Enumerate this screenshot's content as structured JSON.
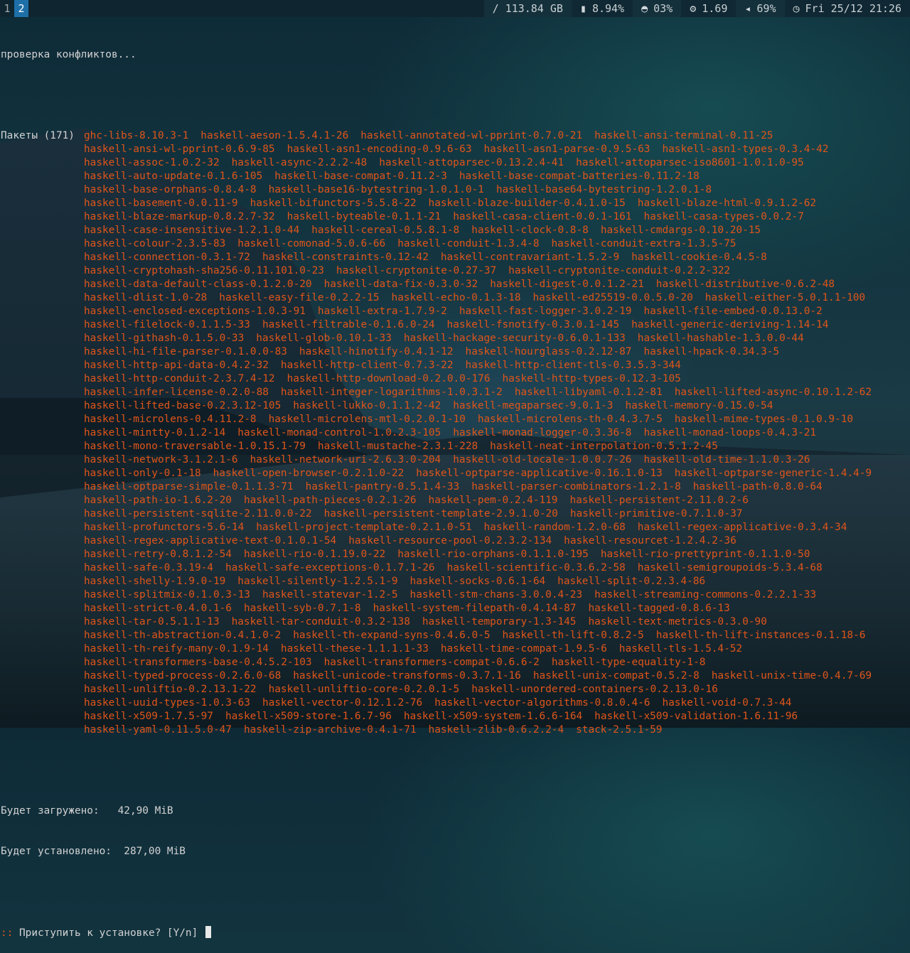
{
  "workspaces": [
    {
      "label": "1",
      "active": false
    },
    {
      "label": "2",
      "active": true
    }
  ],
  "status": {
    "disk": {
      "icon": "folder-slash-icon",
      "value": "/ 113.84 GB"
    },
    "memory": {
      "icon": "memory-icon",
      "value": "8.94%"
    },
    "cpu": {
      "icon": "speedometer-icon",
      "value": "03%"
    },
    "load": {
      "icon": "gears-icon",
      "value": "1.69"
    },
    "volume": {
      "icon": "speaker-icon",
      "value": "69%"
    },
    "clock": {
      "icon": "clock-icon",
      "value": "Fri 25/12 21:26"
    }
  },
  "terminal": {
    "checking": "проверка конфликтов...",
    "packages_label": "Пакеты (171)",
    "packages": [
      [
        "ghc-libs-8.10.3-1",
        "haskell-aeson-1.5.4.1-26",
        "haskell-annotated-wl-pprint-0.7.0-21",
        "haskell-ansi-terminal-0.11-25"
      ],
      [
        "haskell-ansi-wl-pprint-0.6.9-85",
        "haskell-asn1-encoding-0.9.6-63",
        "haskell-asn1-parse-0.9.5-63",
        "haskell-asn1-types-0.3.4-42"
      ],
      [
        "haskell-assoc-1.0.2-32",
        "haskell-async-2.2.2-48",
        "haskell-attoparsec-0.13.2.4-41",
        "haskell-attoparsec-iso8601-1.0.1.0-95"
      ],
      [
        "haskell-auto-update-0.1.6-105",
        "haskell-base-compat-0.11.2-3",
        "haskell-base-compat-batteries-0.11.2-18"
      ],
      [
        "haskell-base-orphans-0.8.4-8",
        "haskell-base16-bytestring-1.0.1.0-1",
        "haskell-base64-bytestring-1.2.0.1-8"
      ],
      [
        "haskell-basement-0.0.11-9",
        "haskell-bifunctors-5.5.8-22",
        "haskell-blaze-builder-0.4.1.0-15",
        "haskell-blaze-html-0.9.1.2-62"
      ],
      [
        "haskell-blaze-markup-0.8.2.7-32",
        "haskell-byteable-0.1.1-21",
        "haskell-casa-client-0.0.1-161",
        "haskell-casa-types-0.0.2-7"
      ],
      [
        "haskell-case-insensitive-1.2.1.0-44",
        "haskell-cereal-0.5.8.1-8",
        "haskell-clock-0.8-8",
        "haskell-cmdargs-0.10.20-15"
      ],
      [
        "haskell-colour-2.3.5-83",
        "haskell-comonad-5.0.6-66",
        "haskell-conduit-1.3.4-8",
        "haskell-conduit-extra-1.3.5-75"
      ],
      [
        "haskell-connection-0.3.1-72",
        "haskell-constraints-0.12-42",
        "haskell-contravariant-1.5.2-9",
        "haskell-cookie-0.4.5-8"
      ],
      [
        "haskell-cryptohash-sha256-0.11.101.0-23",
        "haskell-cryptonite-0.27-37",
        "haskell-cryptonite-conduit-0.2.2-322"
      ],
      [
        "haskell-data-default-class-0.1.2.0-20",
        "haskell-data-fix-0.3.0-32",
        "haskell-digest-0.0.1.2-21",
        "haskell-distributive-0.6.2-48"
      ],
      [
        "haskell-dlist-1.0-28",
        "haskell-easy-file-0.2.2-15",
        "haskell-echo-0.1.3-18",
        "haskell-ed25519-0.0.5.0-20",
        "haskell-either-5.0.1.1-100"
      ],
      [
        "haskell-enclosed-exceptions-1.0.3-91",
        "haskell-extra-1.7.9-2",
        "haskell-fast-logger-3.0.2-19",
        "haskell-file-embed-0.0.13.0-2"
      ],
      [
        "haskell-filelock-0.1.1.5-33",
        "haskell-filtrable-0.1.6.0-24",
        "haskell-fsnotify-0.3.0.1-145",
        "haskell-generic-deriving-1.14-14"
      ],
      [
        "haskell-githash-0.1.5.0-33",
        "haskell-glob-0.10.1-33",
        "haskell-hackage-security-0.6.0.1-133",
        "haskell-hashable-1.3.0.0-44"
      ],
      [
        "haskell-hi-file-parser-0.1.0.0-83",
        "haskell-hinotify-0.4.1-12",
        "haskell-hourglass-0.2.12-87",
        "haskell-hpack-0.34.3-5"
      ],
      [
        "haskell-http-api-data-0.4.2-32",
        "haskell-http-client-0.7.3-22",
        "haskell-http-client-tls-0.3.5.3-344"
      ],
      [
        "haskell-http-conduit-2.3.7.4-12",
        "haskell-http-download-0.2.0.0-176",
        "haskell-http-types-0.12.3-105"
      ],
      [
        "haskell-infer-license-0.2.0-88",
        "haskell-integer-logarithms-1.0.3.1-2",
        "haskell-libyaml-0.1.2-81",
        "haskell-lifted-async-0.10.1.2-62"
      ],
      [
        "haskell-lifted-base-0.2.3.12-105",
        "haskell-lukko-0.1.1.2-42",
        "haskell-megaparsec-9.0.1-3",
        "haskell-memory-0.15.0-54"
      ],
      [
        "haskell-microlens-0.4.11.2-8",
        "haskell-microlens-mtl-0.2.0.1-10",
        "haskell-microlens-th-0.4.3.7-5",
        "haskell-mime-types-0.1.0.9-10"
      ],
      [
        "haskell-mintty-0.1.2-14",
        "haskell-monad-control-1.0.2.3-105",
        "haskell-monad-logger-0.3.36-8",
        "haskell-monad-loops-0.4.3-21"
      ],
      [
        "haskell-mono-traversable-1.0.15.1-79",
        "haskell-mustache-2.3.1-228",
        "haskell-neat-interpolation-0.5.1.2-45"
      ],
      [
        "haskell-network-3.1.2.1-6",
        "haskell-network-uri-2.6.3.0-204",
        "haskell-old-locale-1.0.0.7-26",
        "haskell-old-time-1.1.0.3-26"
      ],
      [
        "haskell-only-0.1-18",
        "haskell-open-browser-0.2.1.0-22",
        "haskell-optparse-applicative-0.16.1.0-13",
        "haskell-optparse-generic-1.4.4-9"
      ],
      [
        "haskell-optparse-simple-0.1.1.3-71",
        "haskell-pantry-0.5.1.4-33",
        "haskell-parser-combinators-1.2.1-8",
        "haskell-path-0.8.0-64"
      ],
      [
        "haskell-path-io-1.6.2-20",
        "haskell-path-pieces-0.2.1-26",
        "haskell-pem-0.2.4-119",
        "haskell-persistent-2.11.0.2-6"
      ],
      [
        "haskell-persistent-sqlite-2.11.0.0-22",
        "haskell-persistent-template-2.9.1.0-20",
        "haskell-primitive-0.7.1.0-37"
      ],
      [
        "haskell-profunctors-5.6-14",
        "haskell-project-template-0.2.1.0-51",
        "haskell-random-1.2.0-68",
        "haskell-regex-applicative-0.3.4-34"
      ],
      [
        "haskell-regex-applicative-text-0.1.0.1-54",
        "haskell-resource-pool-0.2.3.2-134",
        "haskell-resourcet-1.2.4.2-36"
      ],
      [
        "haskell-retry-0.8.1.2-54",
        "haskell-rio-0.1.19.0-22",
        "haskell-rio-orphans-0.1.1.0-195",
        "haskell-rio-prettyprint-0.1.1.0-50"
      ],
      [
        "haskell-safe-0.3.19-4",
        "haskell-safe-exceptions-0.1.7.1-26",
        "haskell-scientific-0.3.6.2-58",
        "haskell-semigroupoids-5.3.4-68"
      ],
      [
        "haskell-shelly-1.9.0-19",
        "haskell-silently-1.2.5.1-9",
        "haskell-socks-0.6.1-64",
        "haskell-split-0.2.3.4-86"
      ],
      [
        "haskell-splitmix-0.1.0.3-13",
        "haskell-statevar-1.2-5",
        "haskell-stm-chans-3.0.0.4-23",
        "haskell-streaming-commons-0.2.2.1-33"
      ],
      [
        "haskell-strict-0.4.0.1-6",
        "haskell-syb-0.7.1-8",
        "haskell-system-filepath-0.4.14-87",
        "haskell-tagged-0.8.6-13"
      ],
      [
        "haskell-tar-0.5.1.1-13",
        "haskell-tar-conduit-0.3.2-138",
        "haskell-temporary-1.3-145",
        "haskell-text-metrics-0.3.0-90"
      ],
      [
        "haskell-th-abstraction-0.4.1.0-2",
        "haskell-th-expand-syns-0.4.6.0-5",
        "haskell-th-lift-0.8.2-5",
        "haskell-th-lift-instances-0.1.18-6"
      ],
      [
        "haskell-th-reify-many-0.1.9-14",
        "haskell-these-1.1.1.1-33",
        "haskell-time-compat-1.9.5-6",
        "haskell-tls-1.5.4-52"
      ],
      [
        "haskell-transformers-base-0.4.5.2-103",
        "haskell-transformers-compat-0.6.6-2",
        "haskell-type-equality-1-8"
      ],
      [
        "haskell-typed-process-0.2.6.0-68",
        "haskell-unicode-transforms-0.3.7.1-16",
        "haskell-unix-compat-0.5.2-8",
        "haskell-unix-time-0.4.7-69"
      ],
      [
        "haskell-unliftio-0.2.13.1-22",
        "haskell-unliftio-core-0.2.0.1-5",
        "haskell-unordered-containers-0.2.13.0-16"
      ],
      [
        "haskell-uuid-types-1.0.3-63",
        "haskell-vector-0.12.1.2-76",
        "haskell-vector-algorithms-0.8.0.4-6",
        "haskell-void-0.7.3-44"
      ],
      [
        "haskell-x509-1.7.5-97",
        "haskell-x509-store-1.6.7-96",
        "haskell-x509-system-1.6.6-164",
        "haskell-x509-validation-1.6.11-96"
      ],
      [
        "haskell-yaml-0.11.5.0-47",
        "haskell-zip-archive-0.4.1-71",
        "haskell-zlib-0.6.2.2-4",
        "stack-2.5.1-59"
      ]
    ],
    "download_label": "Будет загружено:",
    "download_value": "42,90 MiB",
    "install_label": "Будет установлено:",
    "install_value": "287,00 MiB",
    "prompt_prefix": "::",
    "prompt": "Приступить к установке? [Y/n]"
  },
  "colors": {
    "package": "#e0551a",
    "workspace_active": "#1e6fa8",
    "bar_bg": "#0f2530"
  }
}
